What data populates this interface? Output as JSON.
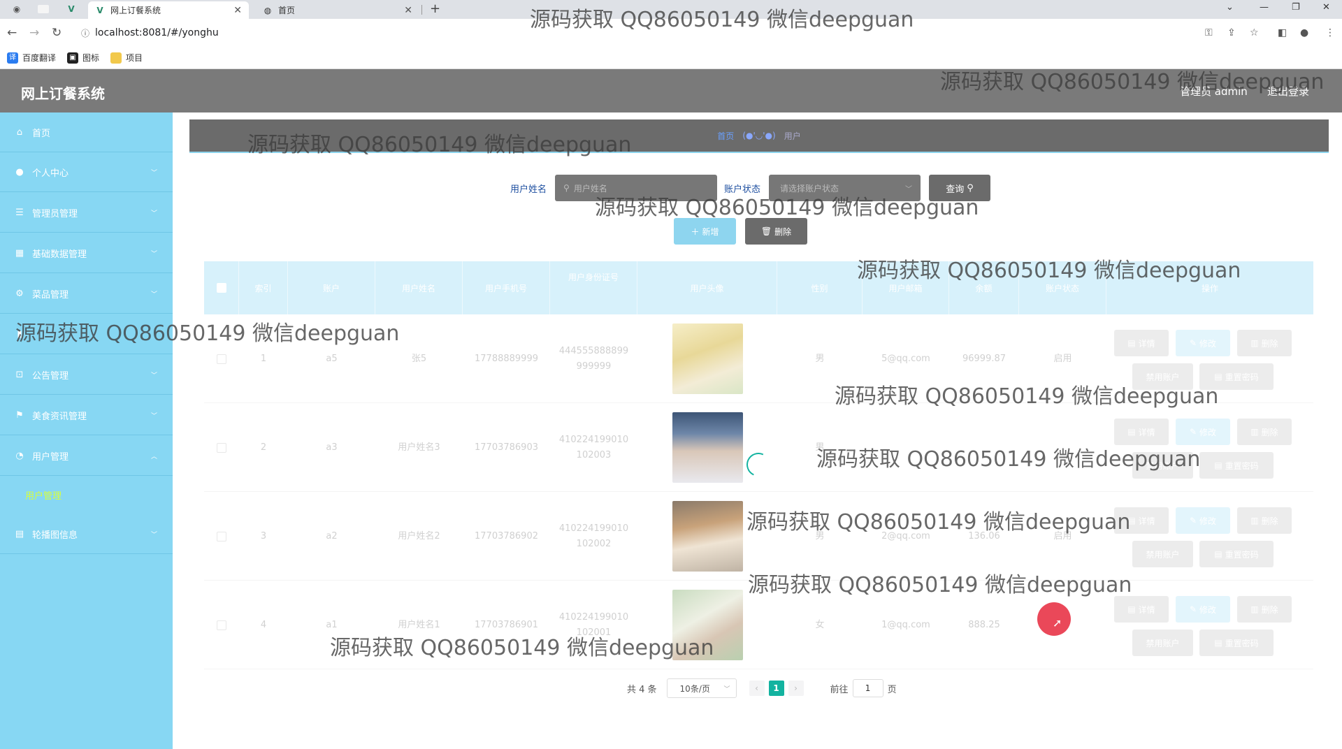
{
  "browser": {
    "tabs": [
      {
        "title": "网上订餐系统",
        "active": true
      },
      {
        "title": "首页",
        "active": false
      }
    ],
    "url": "localhost:8081/#/yonghu",
    "bookmarks": [
      "百度翻译",
      "图标",
      "项目"
    ]
  },
  "header": {
    "title": "网上订餐系统",
    "user": "管理员 admin",
    "logout": "退出登录"
  },
  "sidebar": {
    "items": [
      {
        "label": "首页",
        "icon": "home-icon"
      },
      {
        "label": "个人中心",
        "icon": "user-icon"
      },
      {
        "label": "管理员管理",
        "icon": "list-icon"
      },
      {
        "label": "基础数据管理",
        "icon": "grid-icon"
      },
      {
        "label": "菜品管理",
        "icon": "dish-icon"
      },
      {
        "label": "公告管理",
        "icon": "crop-icon"
      },
      {
        "label": "美食资讯管理",
        "icon": "flag-icon"
      },
      {
        "label": "用户管理",
        "icon": "gauge-icon"
      },
      {
        "label": "轮播图信息",
        "icon": "clipboard-icon"
      }
    ],
    "sub_active": "用户管理"
  },
  "breadcrumb": {
    "home": "首页",
    "sep": "(●'◡'●)",
    "current": "用户"
  },
  "search": {
    "name_label": "用户姓名",
    "name_placeholder": "用户姓名",
    "status_label": "账户状态",
    "status_placeholder": "请选择账户状态",
    "query_button": "查询"
  },
  "actions": {
    "add": "新增",
    "delete": "删除"
  },
  "table": {
    "columns": [
      "索引",
      "账户",
      "用户姓名",
      "用户手机号",
      "用户身份证号",
      "用户头像",
      "性别",
      "用户邮箱",
      "余额",
      "账户状态",
      "操作"
    ],
    "rows": [
      {
        "index": "1",
        "account": "a5",
        "name": "张5",
        "phone": "17788889999",
        "id_line1": "444555888899",
        "id_line2": "999999",
        "gender": "男",
        "email": "5@qq.com",
        "balance": "96999.87",
        "status": "启用"
      },
      {
        "index": "2",
        "account": "a3",
        "name": "用户姓名3",
        "phone": "17703786903",
        "id_line1": "410224199010",
        "id_line2": "102003",
        "gender": "男",
        "email": "",
        "balance": "",
        "status": ""
      },
      {
        "index": "3",
        "account": "a2",
        "name": "用户姓名2",
        "phone": "17703786902",
        "id_line1": "410224199010",
        "id_line2": "102002",
        "gender": "男",
        "email": "2@qq.com",
        "balance": "136.06",
        "status": "启用"
      },
      {
        "index": "4",
        "account": "a1",
        "name": "用户姓名1",
        "phone": "17703786901",
        "id_line1": "410224199010",
        "id_line2": "102001",
        "gender": "女",
        "email": "1@qq.com",
        "balance": "888.25",
        "status": ""
      }
    ],
    "op_labels": {
      "detail": "详情",
      "edit": "修改",
      "delete": "删除",
      "disable": "禁用账户",
      "reset": "重置密码"
    }
  },
  "pagination": {
    "total": "共 4 条",
    "page_size": "10条/页",
    "current_page": "1",
    "goto_label": "前往",
    "goto_value": "1",
    "page_suffix": "页"
  },
  "watermark": "源码获取 QQ86050149 微信deepguan",
  "colors": {
    "sidebar": "#87d7f3",
    "header": "#7a7a7a",
    "active_page": "#13b3a0",
    "submenu_active": "#d8ff3c"
  }
}
